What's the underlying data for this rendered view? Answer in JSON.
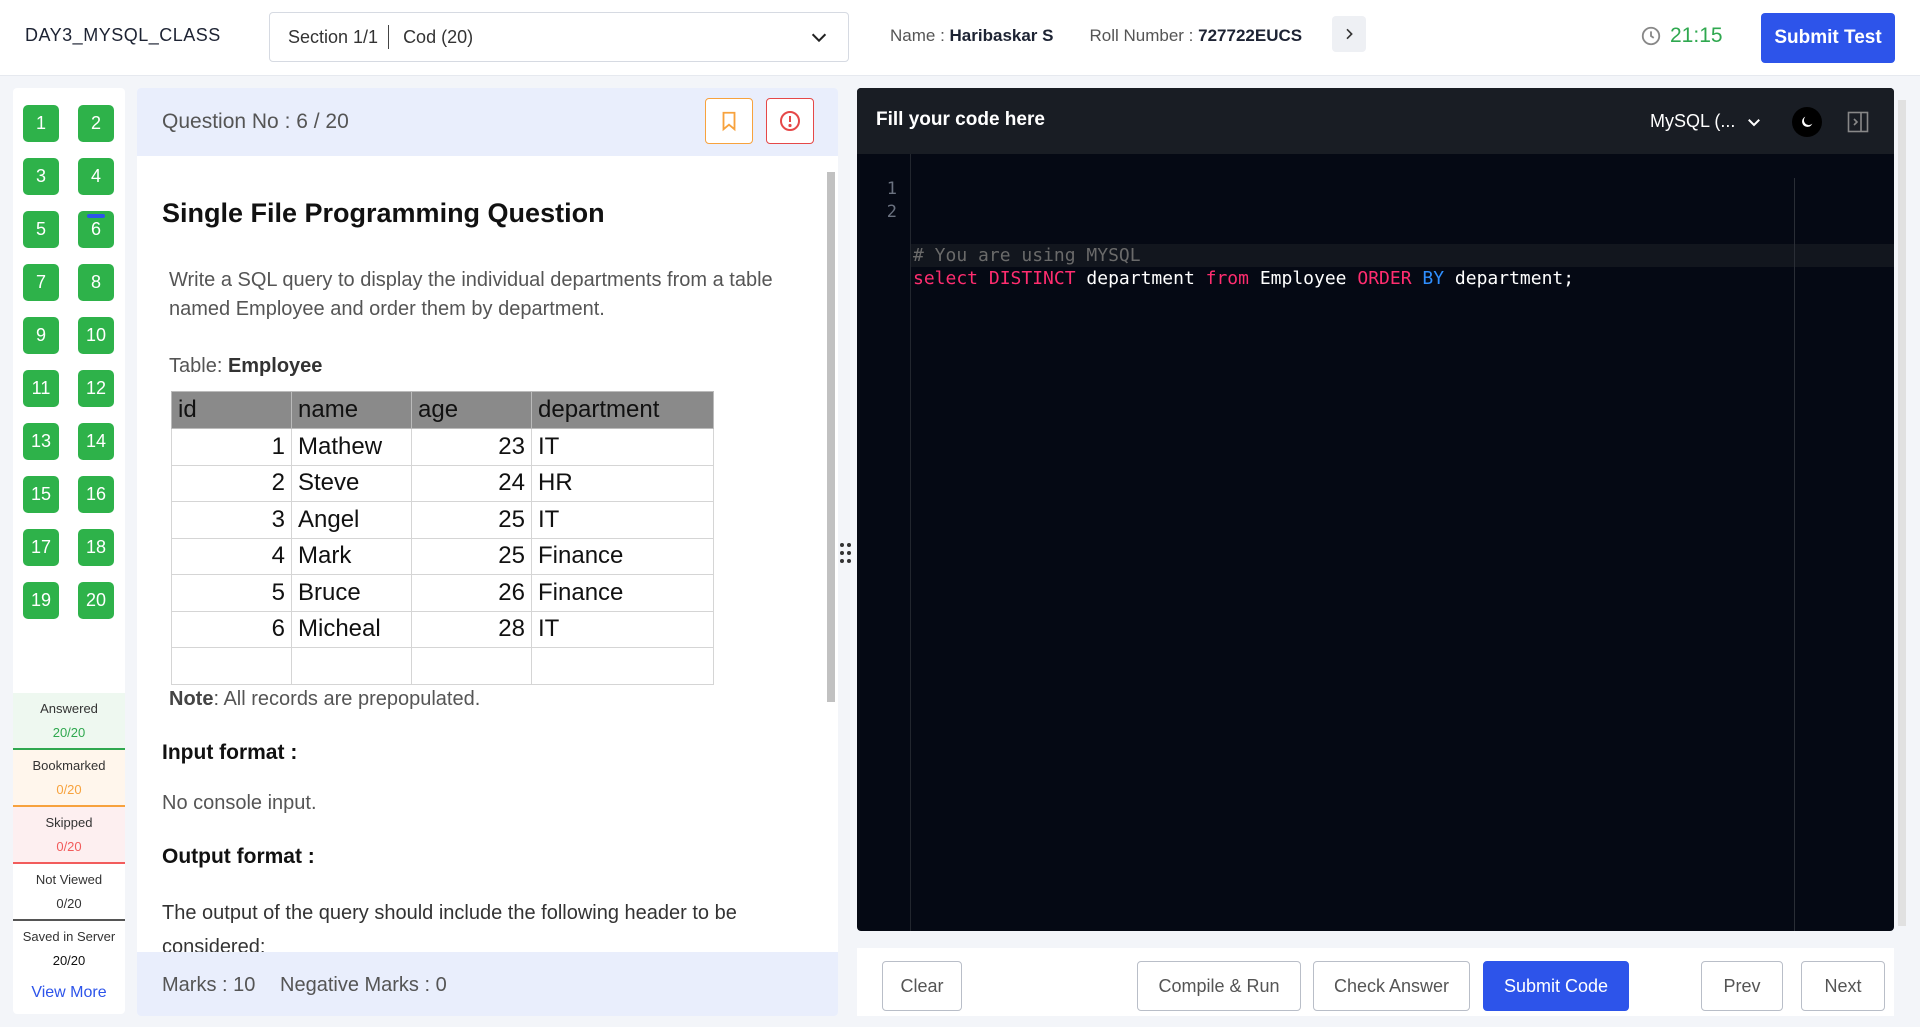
{
  "header": {
    "course": "DAY3_MYSQL_CLASS",
    "section": "Section 1/1",
    "section_sub": "Cod (20)",
    "name_label": "Name : ",
    "name_value": "Haribaskar S",
    "roll_label": "Roll Number : ",
    "roll_value": "727722EUCS",
    "timer": "21:15",
    "submit_test": "Submit Test"
  },
  "nav": {
    "questions": [
      "1",
      "2",
      "3",
      "4",
      "5",
      "6",
      "7",
      "8",
      "9",
      "10",
      "11",
      "12",
      "13",
      "14",
      "15",
      "16",
      "17",
      "18",
      "19",
      "20"
    ],
    "current": "6",
    "stats": {
      "answered_label": "Answered",
      "answered_value": "20/20",
      "bookmarked_label": "Bookmarked",
      "bookmarked_value": "0/20",
      "skipped_label": "Skipped",
      "skipped_value": "0/20",
      "notviewed_label": "Not Viewed",
      "notviewed_value": "0/20",
      "saved_label": "Saved in Server",
      "saved_value": "20/20"
    },
    "view_more": "View More"
  },
  "question": {
    "number": "Question No : 6 / 20",
    "title": "Single File Programming Question",
    "description": "Write a SQL query to display the individual departments from a table named Employee and order them by department.",
    "table_label": "Table: ",
    "table_name": "Employee",
    "table": {
      "headers": [
        "id",
        "name",
        "age",
        "department"
      ],
      "rows": [
        [
          "1",
          "Mathew",
          "23",
          "IT"
        ],
        [
          "2",
          "Steve",
          "24",
          "HR"
        ],
        [
          "3",
          "Angel",
          "25",
          "IT"
        ],
        [
          "4",
          "Mark",
          "25",
          "Finance"
        ],
        [
          "5",
          "Bruce",
          "26",
          "Finance"
        ],
        [
          "6",
          "Micheal",
          "28",
          "IT"
        ]
      ]
    },
    "note_label": "Note",
    "note_text": ": All records are prepopulated.",
    "input_heading": "Input format :",
    "input_text": "No console input.",
    "output_heading": "Output format :",
    "output_text": "The output of the query should include the following header to be considered:",
    "marks": "Marks : 10",
    "negative_marks": "Negative Marks : 0"
  },
  "editor": {
    "title": "Fill your code here",
    "language": "MySQL (...",
    "line_numbers": [
      "1",
      "2"
    ],
    "line1": "# You are using MYSQL",
    "line2_tokens": {
      "t1": "select",
      "t2": " DISTINCT",
      "t3": " department ",
      "t4": "from",
      "t5": " Employee ",
      "t6": "ORDER",
      "t7": " BY",
      "t8": " department;"
    }
  },
  "actions": {
    "clear": "Clear",
    "compile_run": "Compile & Run",
    "check_answer": "Check Answer",
    "submit_code": "Submit Code",
    "prev": "Prev",
    "next": "Next"
  },
  "colors": {
    "accent": "#2d54ea",
    "answered": "#2eb24a",
    "bookmark": "#f7a23d",
    "report": "#e54848",
    "editor_bg": "#050914",
    "keyword": "#ff2d6f",
    "keyword_blue": "#2f8fff"
  },
  "icons": {
    "dropdown": "chevron-down-icon",
    "next": "chevron-right-icon",
    "timer": "clock-icon",
    "bookmark": "bookmark-icon",
    "report": "alert-circle-icon",
    "theme": "moon-icon",
    "panel": "collapse-panel-icon",
    "splitter": "drag-handle-icon"
  }
}
